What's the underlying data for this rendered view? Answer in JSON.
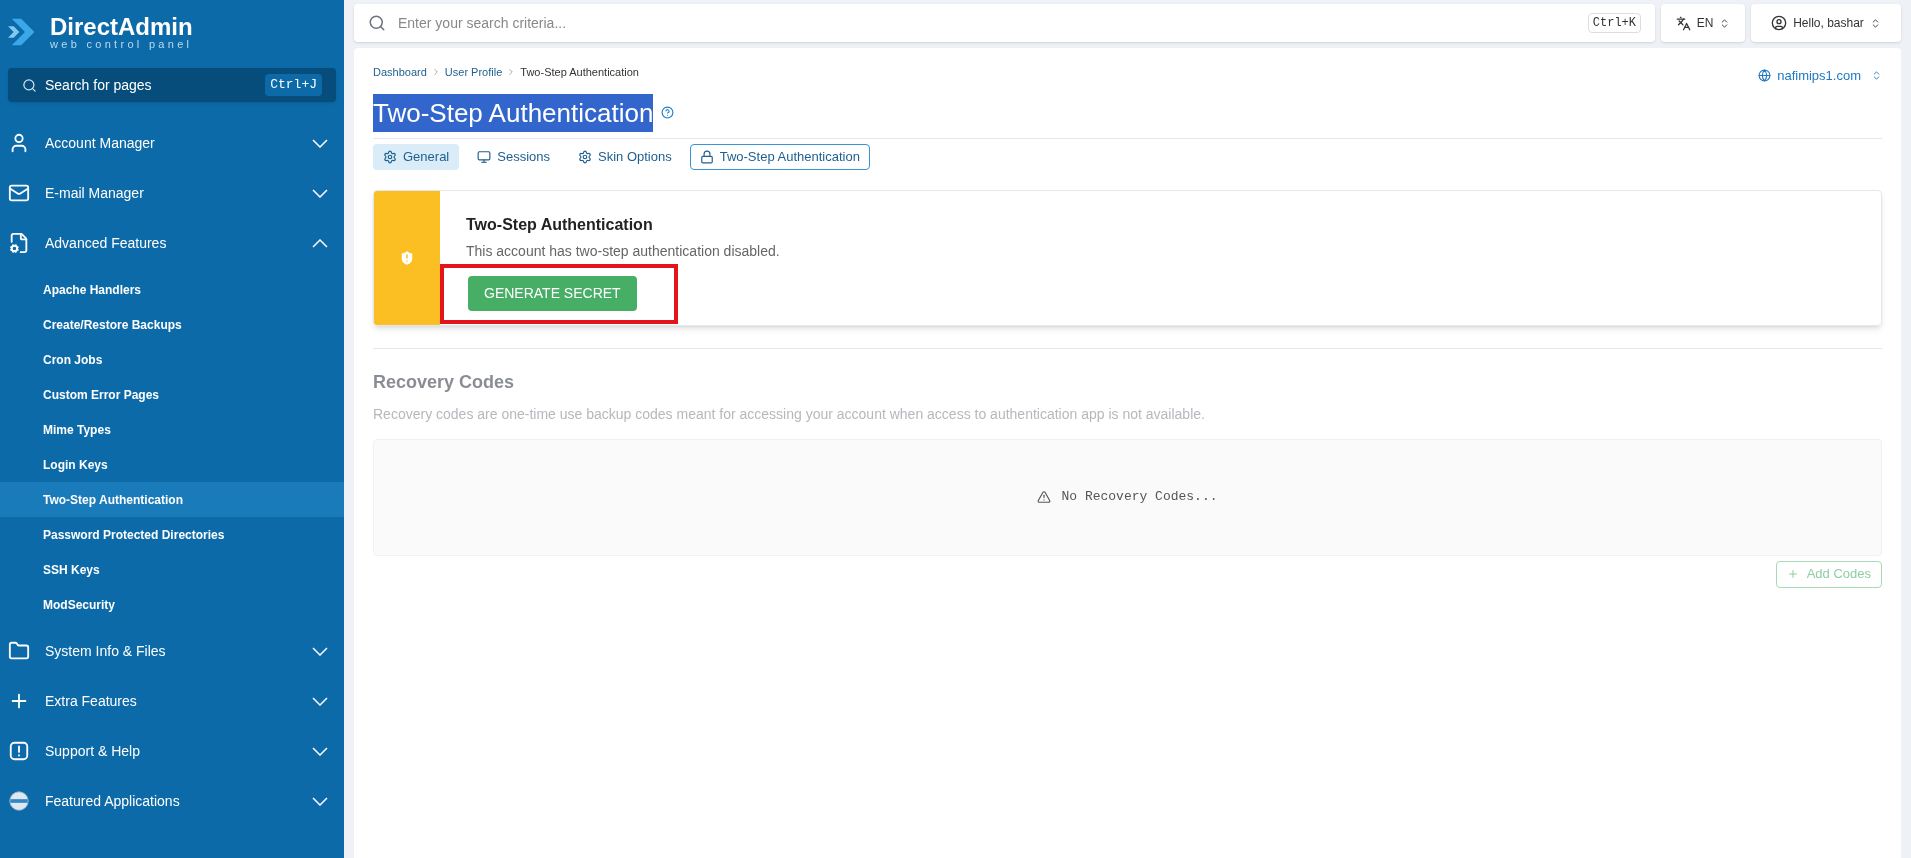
{
  "sidebar": {
    "logo": {
      "name": "DirectAdmin",
      "tagline": "web control panel"
    },
    "search": {
      "placeholder": "Search for pages",
      "shortcut": "Ctrl+J"
    },
    "sections": [
      {
        "label": "Account Manager",
        "kind": "user",
        "expanded": false
      },
      {
        "label": "E-mail Manager",
        "kind": "mail",
        "expanded": false
      },
      {
        "label": "Advanced Features",
        "kind": "advanced",
        "expanded": true,
        "children": [
          {
            "label": "Apache Handlers",
            "selected": false
          },
          {
            "label": "Create/Restore Backups",
            "selected": false
          },
          {
            "label": "Cron Jobs",
            "selected": false
          },
          {
            "label": "Custom Error Pages",
            "selected": false
          },
          {
            "label": "Mime Types",
            "selected": false
          },
          {
            "label": "Login Keys",
            "selected": false
          },
          {
            "label": "Two-Step Authentication",
            "selected": true
          },
          {
            "label": "Password Protected Directories",
            "selected": false
          },
          {
            "label": "SSH Keys",
            "selected": false
          },
          {
            "label": "ModSecurity",
            "selected": false
          }
        ]
      },
      {
        "label": "System Info & Files",
        "kind": "folder",
        "expanded": false
      },
      {
        "label": "Extra Features",
        "kind": "plus",
        "expanded": false
      },
      {
        "label": "Support & Help",
        "kind": "alert",
        "expanded": false
      },
      {
        "label": "Featured Applications",
        "kind": "apps",
        "expanded": false
      }
    ]
  },
  "topbar": {
    "search": {
      "placeholder": "Enter your search criteria...",
      "shortcut": "Ctrl+K"
    },
    "language": "EN",
    "user": "Hello, bashar"
  },
  "breadcrumb": [
    "Dashboard",
    "User Profile",
    "Two-Step Authentication"
  ],
  "domain": "nafimips1.com",
  "page_title": {
    "text": "Two-Step Authentication",
    "highlighted": true
  },
  "tabs": [
    {
      "label": "General",
      "kind": "gear",
      "selected": true,
      "outlined": false
    },
    {
      "label": "Sessions",
      "kind": "monitor",
      "selected": false,
      "outlined": false
    },
    {
      "label": "Skin Options",
      "kind": "gear",
      "selected": false,
      "outlined": false
    },
    {
      "label": "Two-Step Authentication",
      "kind": "lock",
      "selected": false,
      "outlined": true
    }
  ],
  "status_card": {
    "title": "Two-Step Authentication",
    "text": "This account has two-step authentication disabled.",
    "button": "GENERATE SECRET",
    "button_highlighted": true
  },
  "recovery": {
    "title": "Recovery Codes",
    "description": "Recovery codes are one-time use backup codes meant for accessing your account when access to authentication app is not available.",
    "empty_text": "No Recovery Codes...",
    "add_button": {
      "label": "Add Codes",
      "disabled": true
    }
  }
}
